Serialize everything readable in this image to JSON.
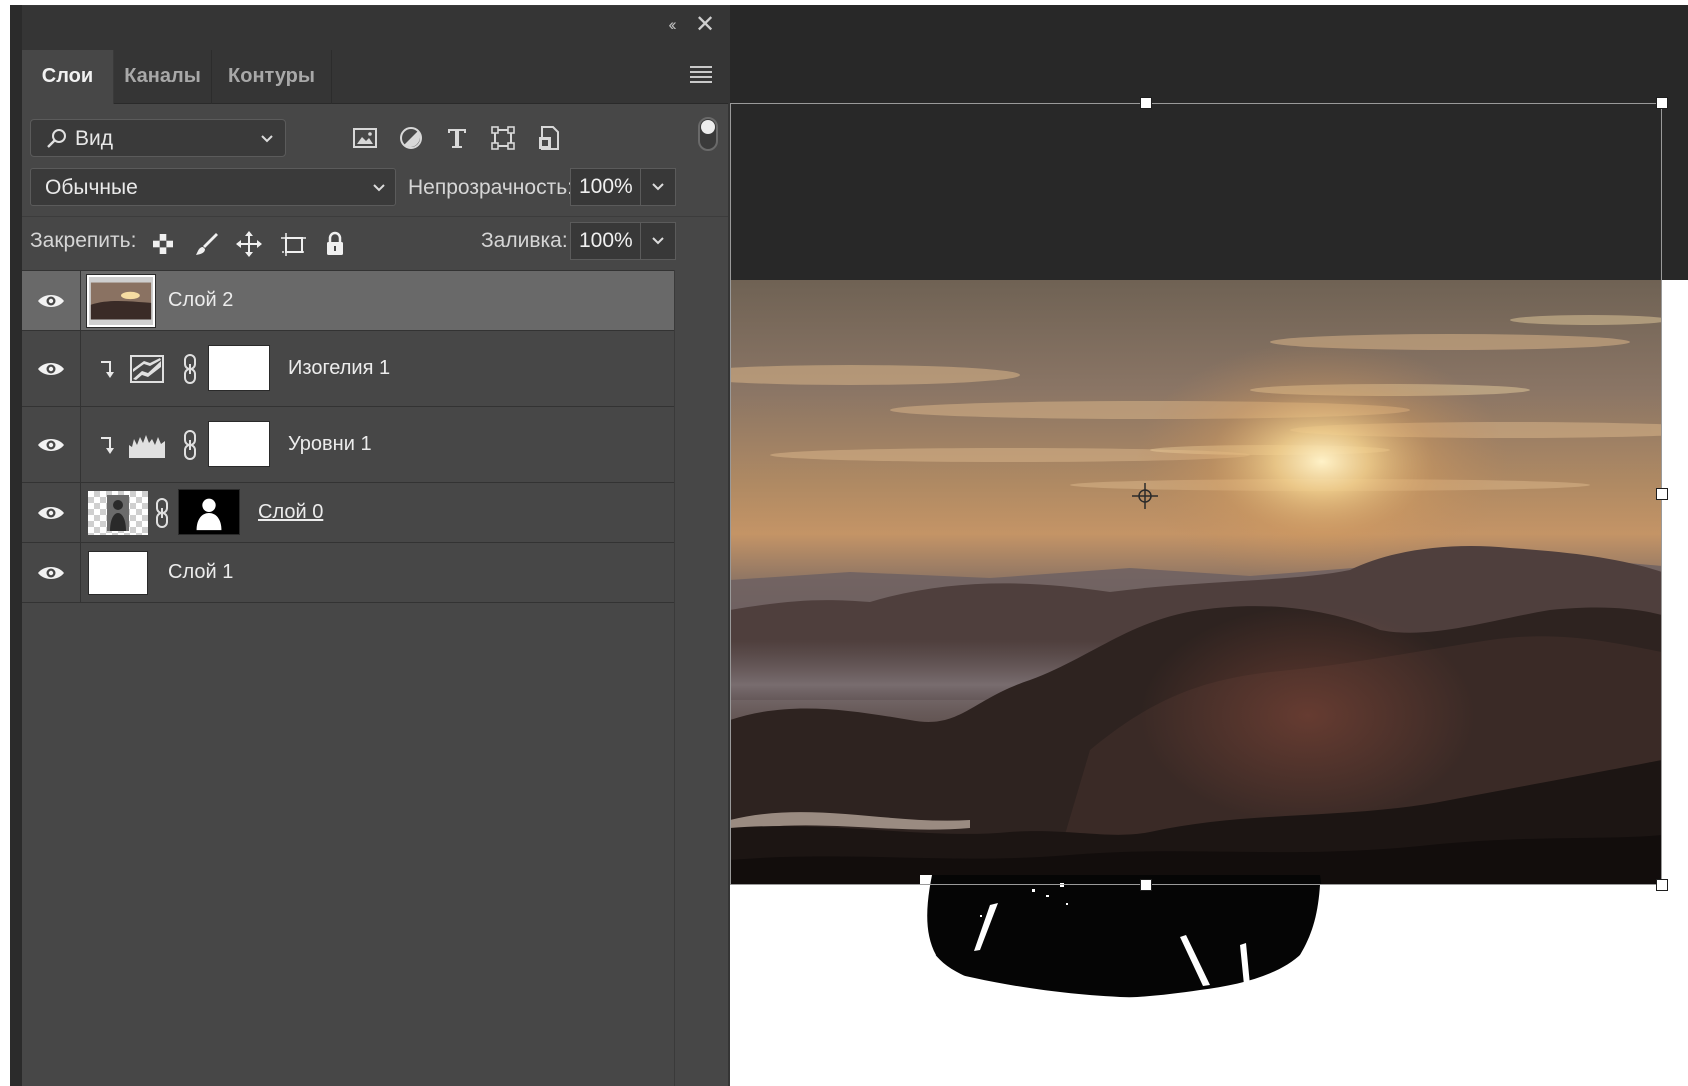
{
  "panel": {
    "tabs": [
      {
        "label": "Слои",
        "active": true
      },
      {
        "label": "Каналы",
        "active": false
      },
      {
        "label": "Контуры",
        "active": false
      }
    ],
    "collapse_glyph": "‹‹",
    "close_glyph": "✕",
    "filter": {
      "kind_label": "Вид",
      "icons": [
        "pixel-layer-filter-icon",
        "adjustment-layer-filter-icon",
        "type-layer-filter-icon",
        "shape-layer-filter-icon",
        "smart-object-filter-icon"
      ],
      "toggle_on": true
    },
    "blend": {
      "mode": "Обычные",
      "opacity_label": "Непрозрачность:",
      "opacity_value": "100%"
    },
    "lock": {
      "label": "Закрепить:",
      "icons": [
        "lock-transparent-pixels-icon",
        "lock-image-pixels-icon",
        "lock-position-icon",
        "lock-artboard-icon",
        "lock-all-icon"
      ],
      "fill_label": "Заливка:",
      "fill_value": "100%"
    },
    "layers": [
      {
        "name": "Слой 2",
        "visible": true,
        "selected": true,
        "kind": "image"
      },
      {
        "name": "Изогелия 1",
        "visible": true,
        "selected": false,
        "kind": "adjustment",
        "adjustment": "posterize-icon",
        "clipped": true,
        "mask": "white"
      },
      {
        "name": "Уровни 1",
        "visible": true,
        "selected": false,
        "kind": "adjustment",
        "adjustment": "levels-icon",
        "clipped": true,
        "mask": "white"
      },
      {
        "name": "Слой 0",
        "visible": true,
        "selected": false,
        "kind": "masked-image",
        "mask": "silhouette",
        "underlined": true
      },
      {
        "name": "Слой 1",
        "visible": true,
        "selected": false,
        "kind": "white-fill"
      }
    ]
  },
  "colors": {
    "panel_bg": "#474747",
    "panel_header": "#353535",
    "selected_row": "#696969",
    "pasteboard": "#282828",
    "text": "#e6e6e6"
  }
}
